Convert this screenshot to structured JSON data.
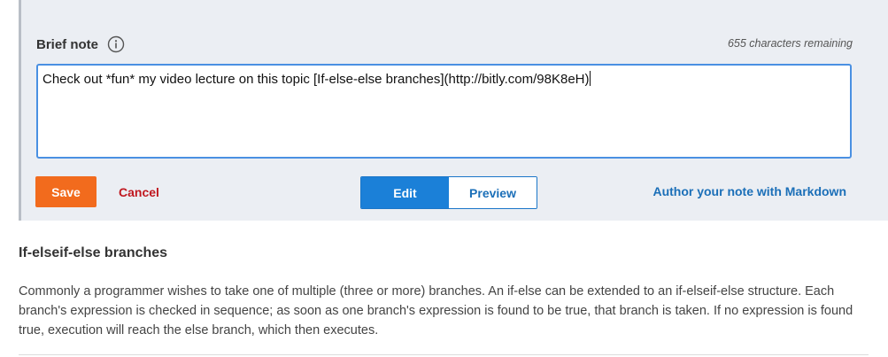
{
  "note": {
    "title": "Brief note",
    "info_icon": "info-circle-icon",
    "chars_remaining": "655 characters remaining",
    "text_value": "Check out *fun* my video lecture on this topic [If-else-else branches](http://bitly.com/98K8eH)",
    "save_label": "Save",
    "cancel_label": "Cancel",
    "edit_label": "Edit",
    "preview_label": "Preview",
    "markdown_link": "Author your note with Markdown"
  },
  "section": {
    "title": "If-elseif-else branches",
    "body": "Commonly a programmer wishes to take one of multiple (three or more) branches. An if-else can be extended to an if-elseif-else structure. Each branch's expression is checked in sequence; as soon as one branch's expression is found to be true, that branch is taken. If no expression is found true, execution will reach the else branch, which then executes."
  },
  "colors": {
    "panel_bg": "#ebeef3",
    "save": "#f26b1d",
    "cancel": "#c0171f",
    "accent": "#1b80d8",
    "link": "#1b6fb8",
    "focus_border": "#4a90e2"
  }
}
